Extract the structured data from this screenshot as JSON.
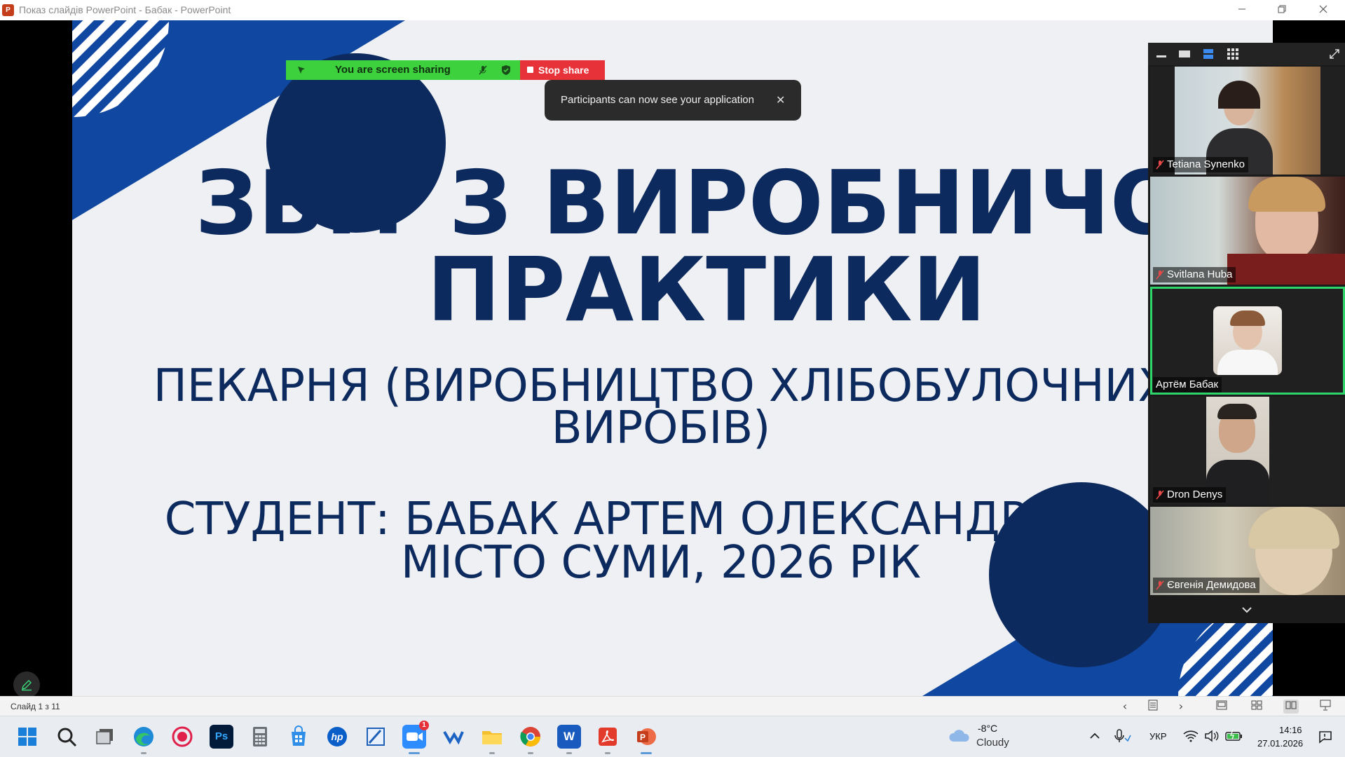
{
  "window": {
    "title": "Показ слайдів PowerPoint  -  Бабак  -  PowerPoint",
    "app_icon_letter": "P",
    "controls": [
      "minimize-icon",
      "restore-icon",
      "close-icon"
    ]
  },
  "slide": {
    "title_line1": "ЗВІТ З ВИРОБНИЧОЇ",
    "title_line2": "ПРАКТИКИ",
    "subtitle_line1": "ПЕКАРНЯ (ВИРОБНИЦТВО ХЛІБОБУЛОЧНИХ",
    "subtitle_line2": "ВИРОБІВ)",
    "student_line": "СТУДЕНТ: БАБАК АРТЕМ ОЛЕКСАНДРОВИЧ",
    "city_line": "МІСТО СУМИ, 2026 РІК",
    "colors": {
      "navy": "#0d2a5e",
      "blue": "#0f47a1",
      "background": "#eef0f3"
    }
  },
  "share": {
    "status_text": "You are screen sharing",
    "stop_label": "Stop share",
    "colors": {
      "green": "#3dd13d",
      "red": "#e8323a"
    }
  },
  "toast": {
    "message": "Participants can now see your application"
  },
  "video_panel": {
    "view_icons": [
      "minimize-icon",
      "speaker-view-icon",
      "strip-view-icon",
      "gallery-view-icon"
    ],
    "expand_icon": "expand-icon",
    "participants": [
      {
        "name": "Tetiana Synenko",
        "muted": true,
        "active": false
      },
      {
        "name": "Svitlana Huba",
        "muted": true,
        "active": false
      },
      {
        "name": "Артём Бабак",
        "muted": false,
        "active": true
      },
      {
        "name": "Dron Denys",
        "muted": true,
        "active": false
      },
      {
        "name": "Євгенія Демидова",
        "muted": true,
        "active": false
      }
    ],
    "scroll_icon": "chevron-down-icon"
  },
  "statusbar": {
    "slide_counter": "Слайд 1 з 11"
  },
  "taskbar": {
    "apps": [
      "windows-start-icon",
      "search-icon",
      "task-view-icon",
      "edge-icon",
      "recorder-icon",
      "photoshop-icon",
      "calculator-icon",
      "store-icon",
      "hp-icon",
      "snipping-icon",
      "zoom-icon",
      "viber-icon",
      "file-explorer-icon",
      "chrome-icon",
      "word-icon",
      "acrobat-icon",
      "powerpoint-icon"
    ],
    "zoom_badge": "1",
    "photoshop_label": "Ps",
    "word_label": "W",
    "hp_label": "hp",
    "weather": {
      "temp": "-8°C",
      "condition": "Cloudy"
    },
    "language": "УКР",
    "time": "14:16",
    "date": "27.01.2026"
  }
}
